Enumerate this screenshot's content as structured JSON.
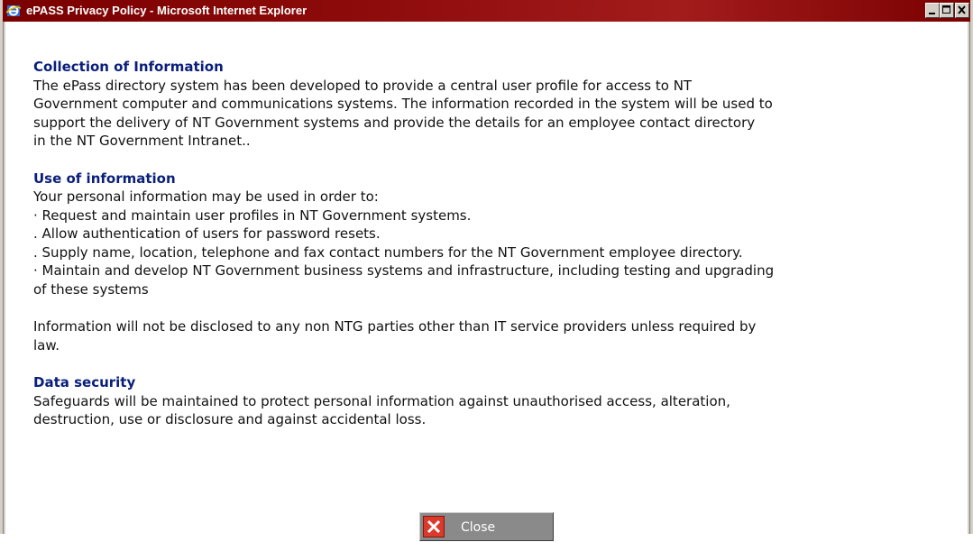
{
  "window": {
    "title": "ePASS Privacy Policy - Microsoft Internet Explorer",
    "icon": "internet-explorer-icon",
    "controls": {
      "minimize": "minimize-icon",
      "maximize": "maximize-icon",
      "close": "close-icon"
    }
  },
  "colors": {
    "titlebar": "#7a0000",
    "heading": "#0a1f7a",
    "close_button": "#8a8a8a",
    "close_icon": "#d93a2b"
  },
  "sections": [
    {
      "heading": "Collection of Information",
      "lines": [
        "The ePass directory system has been developed to provide a central user profile for access to NT",
        "Government computer and communications systems. The information recorded in the system will be used to",
        "support the delivery of NT Government systems and provide the details for an employee contact directory",
        "in the NT Government Intranet.."
      ]
    },
    {
      "heading": "Use of information",
      "lines": [
        "Your personal information may be used in order to:",
        "· Request and maintain user profiles in NT Government systems.",
        ". Allow authentication of users for password resets.",
        ". Supply name, location, telephone and fax contact numbers for the NT Government employee directory.",
        "· Maintain and develop NT Government business systems and infrastructure, including testing and upgrading",
        "of these systems"
      ],
      "extra_lines": [
        "Information will not be disclosed to any non NTG parties other than IT service providers unless required by",
        "law."
      ]
    },
    {
      "heading": "Data security",
      "lines": [
        "Safeguards will be maintained to protect personal information against unauthorised access, alteration,",
        "destruction, use or disclosure and against accidental loss."
      ]
    }
  ],
  "close_button": {
    "label": "Close",
    "icon": "close-x-icon"
  }
}
